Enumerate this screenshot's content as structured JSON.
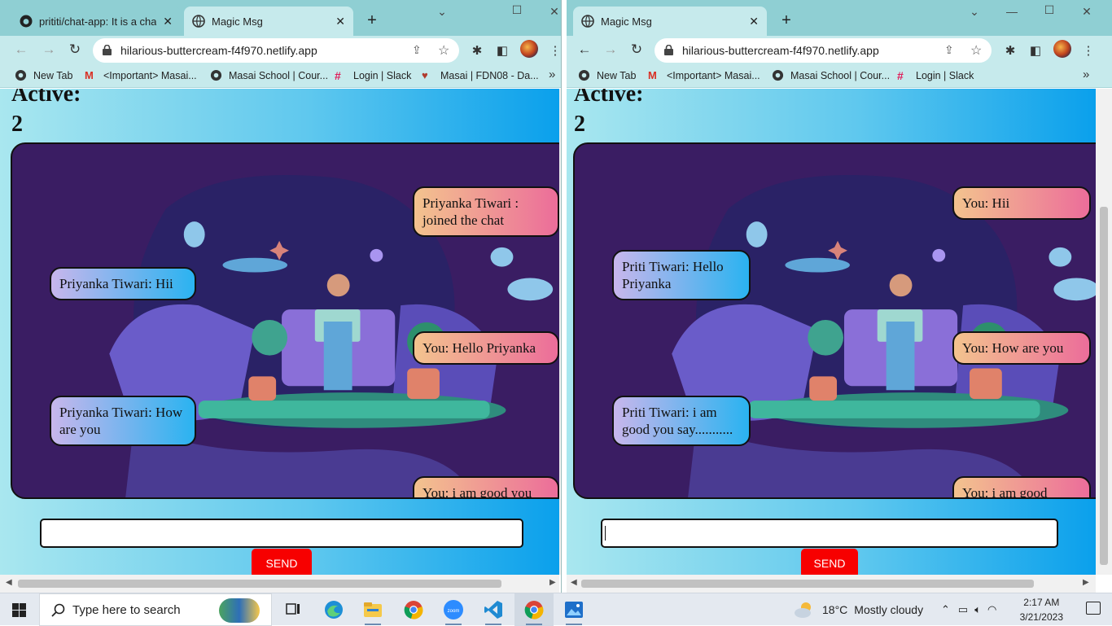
{
  "left_window": {
    "tabs": [
      {
        "label": "prititi/chat-app: It is a chatin",
        "icon": "github-icon",
        "active": false
      },
      {
        "label": "Magic Msg",
        "icon": "globe-icon",
        "active": true
      }
    ],
    "url": "hilarious-buttercream-f4f970.netlify.app",
    "bookmarks": [
      {
        "label": "New Tab",
        "icon": "globe-icon"
      },
      {
        "label": "<Important> Masai...",
        "icon": "gmail-icon"
      },
      {
        "label": "Masai School | Cour...",
        "icon": "globe-icon"
      },
      {
        "label": "Login | Slack",
        "icon": "slack-icon"
      },
      {
        "label": "Masai | FDN08 - Da...",
        "icon": "masai-icon"
      }
    ],
    "active_label": "Active:",
    "active_count": "2",
    "messages": [
      {
        "text": "Priyanka Tiwari : joined the chat",
        "side": "right"
      },
      {
        "text": "Priyanka Tiwari: Hii",
        "side": "left"
      },
      {
        "text": "You: Hello Priyanka",
        "side": "right"
      },
      {
        "text": "Priyanka Tiwari: How are you",
        "side": "left"
      },
      {
        "text": "You: i am good you",
        "side": "right"
      }
    ],
    "input_value": "",
    "send_label": "SEND"
  },
  "right_window": {
    "tabs": [
      {
        "label": "Magic Msg",
        "icon": "globe-icon",
        "active": true
      }
    ],
    "url": "hilarious-buttercream-f4f970.netlify.app",
    "bookmarks": [
      {
        "label": "New Tab",
        "icon": "globe-icon"
      },
      {
        "label": "<Important> Masai...",
        "icon": "gmail-icon"
      },
      {
        "label": "Masai School | Cour...",
        "icon": "globe-icon"
      },
      {
        "label": "Login | Slack",
        "icon": "slack-icon"
      }
    ],
    "active_label": "Active:",
    "active_count": "2",
    "messages": [
      {
        "text": "You: Hii",
        "side": "right"
      },
      {
        "text": "Priti Tiwari: Hello Priyanka",
        "side": "left"
      },
      {
        "text": "You: How are you",
        "side": "right"
      },
      {
        "text": "Priti Tiwari: i am good you say...........",
        "side": "left"
      },
      {
        "text": "You: i am good",
        "side": "right"
      }
    ],
    "input_value": "",
    "send_label": "SEND"
  },
  "taskbar": {
    "search_placeholder": "Type here to search",
    "apps": [
      "task-view",
      "edge",
      "file-explorer",
      "chrome",
      "zoom",
      "vscode",
      "chrome",
      "photos"
    ],
    "weather_temp": "18°C",
    "weather_text": "Mostly cloudy",
    "time": "2:17 AM",
    "date": "3/21/2023"
  },
  "colors": {
    "tabstrip": "#8fcfd3",
    "toolbar": "#c6eaec",
    "send_button": "#f70000",
    "bubble_left": "#2ab3f0",
    "bubble_right": "#ec6d9a",
    "chat_bg": "#3a1d63"
  }
}
